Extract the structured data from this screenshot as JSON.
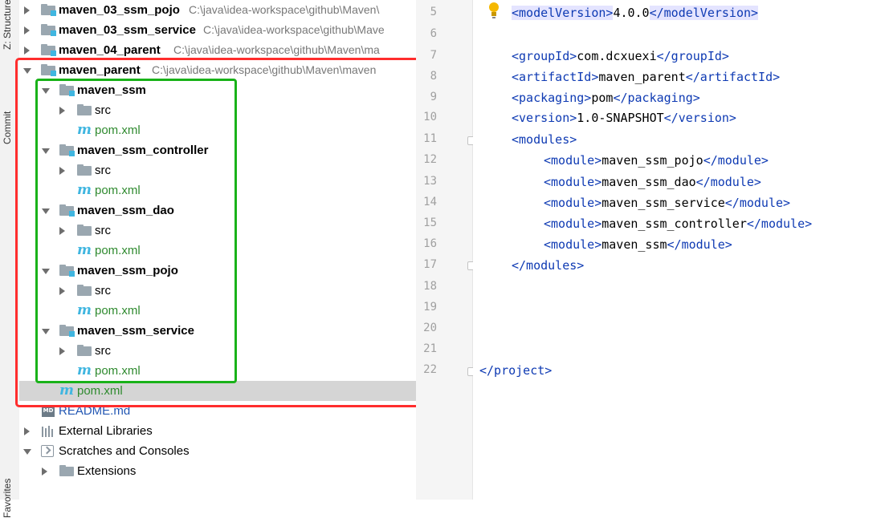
{
  "side_strip": {
    "tabs": [
      "Z: Structure",
      "Commit",
      "Favorites"
    ]
  },
  "tree": {
    "top_modules": [
      {
        "name": "maven_03_ssm_pojo",
        "path": "C:\\java\\idea-workspace\\github\\Maven\\"
      },
      {
        "name": "maven_03_ssm_service",
        "path": "C:\\java\\idea-workspace\\github\\Mave"
      },
      {
        "name": "maven_04_parent",
        "path": "C:\\java\\idea-workspace\\github\\Maven\\ma"
      }
    ],
    "parent": {
      "name": "maven_parent",
      "path": "C:\\java\\idea-workspace\\github\\Maven\\maven"
    },
    "children": [
      {
        "name": "maven_ssm",
        "src": "src",
        "pom": "pom.xml"
      },
      {
        "name": "maven_ssm_controller",
        "src": "src",
        "pom": "pom.xml"
      },
      {
        "name": "maven_ssm_dao",
        "src": "src",
        "pom": "pom.xml"
      },
      {
        "name": "maven_ssm_pojo",
        "src": "src",
        "pom": "pom.xml"
      },
      {
        "name": "maven_ssm_service",
        "src": "src",
        "pom": "pom.xml"
      }
    ],
    "parent_pom": "pom.xml",
    "readme": "README.md",
    "external_libraries": "External Libraries",
    "scratches": "Scratches and Consoles",
    "extensions": "Extensions"
  },
  "editor": {
    "line_numbers": [
      "5",
      "6",
      "7",
      "8",
      "9",
      "10",
      "11",
      "12",
      "13",
      "14",
      "15",
      "16",
      "17",
      "18",
      "19",
      "20",
      "21",
      "22"
    ],
    "lines": [
      {
        "open": "<modelVersion>",
        "text": "4.0.0",
        "close": "</modelVersion>"
      },
      {
        "open": "<groupId>",
        "text": "com.dcxuexi",
        "close": "</groupId>"
      },
      {
        "open": "<artifactId>",
        "text": "maven_parent",
        "close": "</artifactId>"
      },
      {
        "open": "<packaging>",
        "text": "pom",
        "close": "</packaging>"
      },
      {
        "open": "<version>",
        "text": "1.0-SNAPSHOT",
        "close": "</version>"
      },
      {
        "open": "<modules>",
        "text": "",
        "close": ""
      },
      {
        "open": "<module>",
        "text": "maven_ssm_pojo",
        "close": "</module>"
      },
      {
        "open": "<module>",
        "text": "maven_ssm_dao",
        "close": "</module>"
      },
      {
        "open": "<module>",
        "text": "maven_ssm_service",
        "close": "</module>"
      },
      {
        "open": "<module>",
        "text": "maven_ssm_controller",
        "close": "</module>"
      },
      {
        "open": "<module>",
        "text": "maven_ssm",
        "close": "</module>"
      },
      {
        "open": "</modules>",
        "text": "",
        "close": ""
      },
      {
        "open": "</project>",
        "text": "",
        "close": ""
      }
    ]
  }
}
